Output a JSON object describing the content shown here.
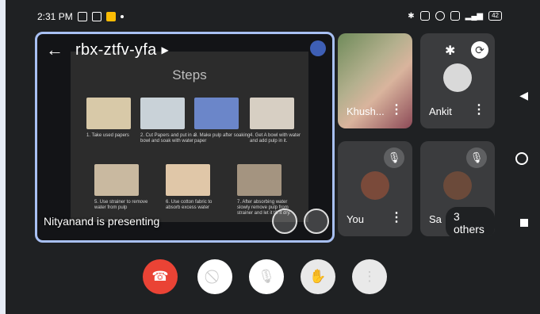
{
  "status_bar": {
    "time": "2:31 PM",
    "battery": "42"
  },
  "meeting": {
    "code": "rbx-ztfv-yfa",
    "presenting_label": "Nityanand is presenting"
  },
  "slide": {
    "title": "Steps",
    "steps": [
      {
        "text": "1. Take used papers",
        "color": "#d8c9a8"
      },
      {
        "text": "2. Cut Papers and put in a bowl and soak with water",
        "color": "#c9d2d8"
      },
      {
        "text": "3. Make pulp after soaking paper",
        "color": "#6b86c9"
      },
      {
        "text": "4. Get A bowl with water and add pulp in it.",
        "color": "#d7cfc3"
      },
      {
        "text": "5. Use strainer to remove water from pulp",
        "color": "#c9b9a0"
      },
      {
        "text": "6. Use cotton fabric to absorb excess water",
        "color": "#e0c7a8"
      },
      {
        "text": "7. After absorbing water slowly remove pulp from strainer and let it till it dry.",
        "color": "#a49480"
      }
    ]
  },
  "participants": [
    {
      "name": "Khush...",
      "muted": false
    },
    {
      "name": "Ankit",
      "muted": false
    },
    {
      "name": "You",
      "muted": true
    },
    {
      "name": "Sa",
      "muted": true,
      "overflow_label": "3 others"
    }
  ],
  "controls": {
    "end_call": "end-call",
    "camera": "camera-off",
    "mic": "mic-off",
    "hand": "raise-hand",
    "more": "more-options"
  },
  "colors": {
    "presenter_border": "#a8c0f3",
    "end_call": "#ea4335",
    "tile_bg": "#3b3c3e"
  }
}
